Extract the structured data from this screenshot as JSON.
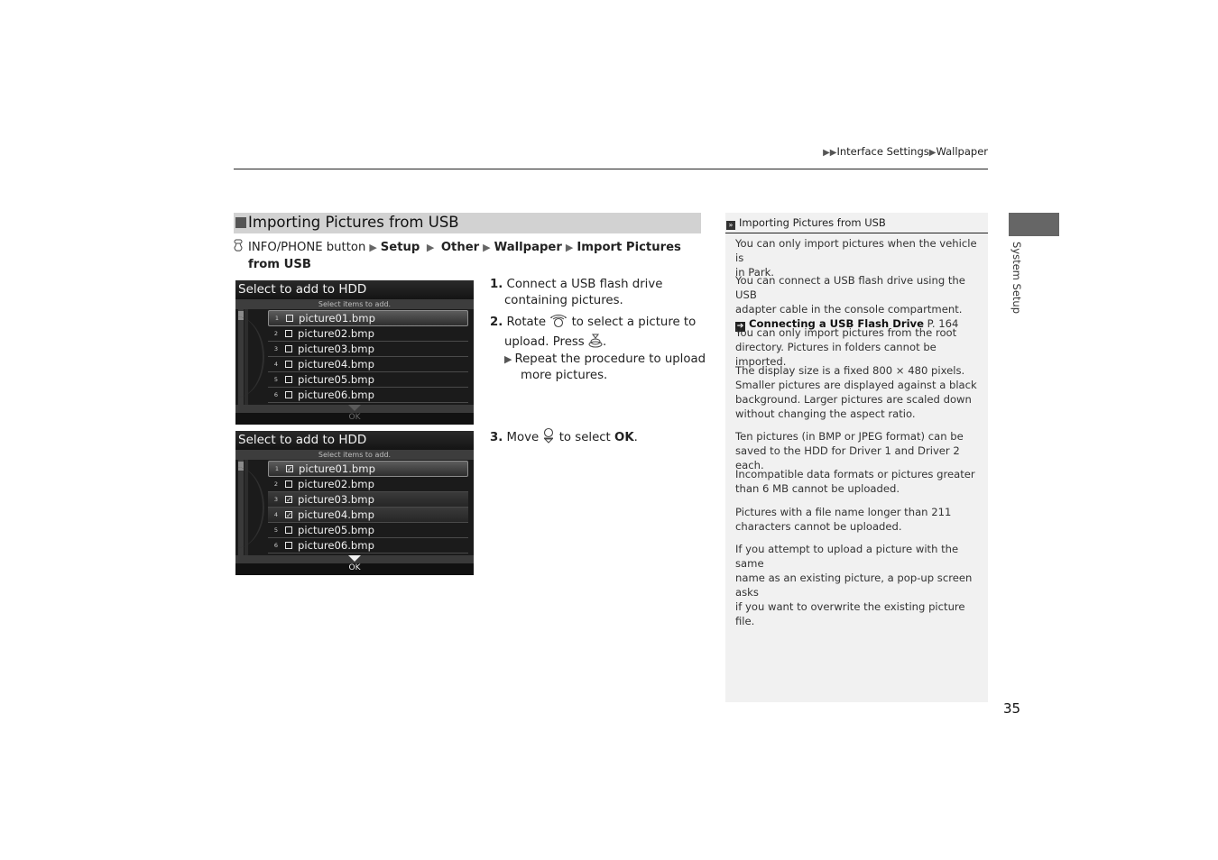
{
  "breadcrumb": {
    "prefix_icon": "double-triangle-right-icon",
    "items": [
      "Interface Settings",
      "Wallpaper"
    ]
  },
  "section": {
    "title": "Importing Pictures from USB",
    "path_icon": "voice-button-icon",
    "path": {
      "start": "INFO/PHONE button",
      "steps": [
        "Setup",
        "Other",
        "Wallpaper",
        "Import Pictures"
      ],
      "line2": "from USB"
    }
  },
  "screens": [
    {
      "title": "Select to add to HDD",
      "subtitle": "Select items to add.",
      "ok_label": "OK",
      "ok_active": false,
      "items": [
        {
          "num": "1",
          "name": "picture01.bmp",
          "checked": false,
          "highlighted": true
        },
        {
          "num": "2",
          "name": "picture02.bmp",
          "checked": false,
          "highlighted": false
        },
        {
          "num": "3",
          "name": "picture03.bmp",
          "checked": false,
          "highlighted": false
        },
        {
          "num": "4",
          "name": "picture04.bmp",
          "checked": false,
          "highlighted": false
        },
        {
          "num": "5",
          "name": "picture05.bmp",
          "checked": false,
          "highlighted": false
        },
        {
          "num": "6",
          "name": "picture06.bmp",
          "checked": false,
          "highlighted": false
        }
      ]
    },
    {
      "title": "Select to add to HDD",
      "subtitle": "Select items to add.",
      "ok_label": "OK",
      "ok_active": true,
      "items": [
        {
          "num": "1",
          "name": "picture01.bmp",
          "checked": true,
          "highlighted": true
        },
        {
          "num": "2",
          "name": "picture02.bmp",
          "checked": false,
          "highlighted": false
        },
        {
          "num": "3",
          "name": "picture03.bmp",
          "checked": true,
          "highlighted": false
        },
        {
          "num": "4",
          "name": "picture04.bmp",
          "checked": true,
          "highlighted": false
        },
        {
          "num": "5",
          "name": "picture05.bmp",
          "checked": false,
          "highlighted": false
        },
        {
          "num": "6",
          "name": "picture06.bmp",
          "checked": false,
          "highlighted": false
        }
      ]
    }
  ],
  "steps": {
    "s1": {
      "num": "1.",
      "line1": "Connect a USB flash drive",
      "line2": "containing pictures."
    },
    "s2": {
      "num": "2.",
      "pre": "Rotate",
      "rotate_icon": "interface-dial-rotate-icon",
      "mid": "to select a picture to",
      "line2_pre": "upload. Press",
      "press_icon": "interface-dial-press-icon",
      "line2_post": "."
    },
    "s2_sub": {
      "icon": "triangle-right-icon",
      "line1": "Repeat the procedure to upload",
      "line2": "more pictures."
    },
    "s3": {
      "num": "3.",
      "pre": "Move",
      "move_icon": "interface-dial-move-down-icon",
      "mid": "to select",
      "target": "OK",
      "post": "."
    }
  },
  "note": {
    "header_icon": "note-double-arrow-icon",
    "title": "Importing Pictures from USB",
    "paragraphs": [
      [
        "You can only import pictures when the vehicle is",
        "in Park."
      ],
      [
        "You can connect a USB flash drive using the USB",
        "adapter cable in the console compartment."
      ],
      [
        "You can only import pictures from the root",
        "directory. Pictures in folders cannot be imported."
      ],
      [
        "The display size is a fixed 800 × 480 pixels.",
        "Smaller pictures are displayed against a black",
        "background. Larger pictures are scaled down",
        "without changing the aspect ratio."
      ],
      [
        "Ten pictures (in BMP or JPEG format) can be",
        "saved to the HDD for Driver 1 and Driver 2 each."
      ],
      [
        "Incompatible data formats or pictures greater",
        "than 6 MB cannot be uploaded."
      ],
      [
        "Pictures with a file name longer than 211",
        "characters cannot be uploaded."
      ],
      [
        "If you attempt to upload a picture with the same",
        "name as an existing picture, a pop-up screen asks",
        "if you want to overwrite the existing picture file."
      ]
    ],
    "link": {
      "icon": "cross-reference-arrow-icon",
      "label": "Connecting a USB Flash Drive",
      "page": "P. 164"
    }
  },
  "side_tab": {
    "label": "System Setup",
    "color": "#666666"
  },
  "page_number": "35"
}
